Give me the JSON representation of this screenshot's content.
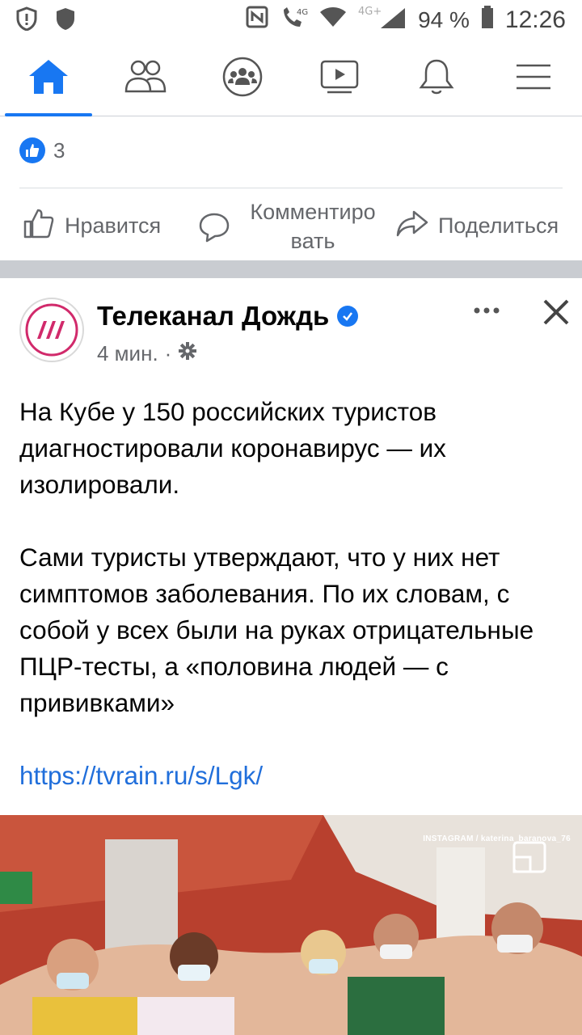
{
  "status_bar": {
    "network": "4G+",
    "battery": "94 %",
    "time": "12:26"
  },
  "nav": {
    "items": [
      {
        "id": "home",
        "icon": "home-icon",
        "active": true
      },
      {
        "id": "friends",
        "icon": "friends-icon",
        "active": false
      },
      {
        "id": "groups",
        "icon": "groups-icon",
        "active": false
      },
      {
        "id": "watch",
        "icon": "video-icon",
        "active": false
      },
      {
        "id": "notifications",
        "icon": "bell-icon",
        "active": false
      },
      {
        "id": "menu",
        "icon": "hamburger-icon",
        "active": false
      }
    ],
    "accent": "#1877f2"
  },
  "reactions": {
    "count": "3"
  },
  "actions": {
    "like": "Нравится",
    "comment": "Комментиро\nвать",
    "share": "Поделиться"
  },
  "post": {
    "page_name": "Телеканал Дождь",
    "time": "4 мин.",
    "paragraph1": "На Кубе у 150 российских туристов диагностировали коронавирус — их изолировали.",
    "paragraph2": "Сами туристы утверждают, что у них нет симптомов заболевания. По их словам, с собой у всех были на руках отрицательные ПЦР-тесты, а «половина людей — с прививками»",
    "link": "https://tvrain.ru/s/Lgk/"
  },
  "video": {
    "watermark": "INSTAGRAM / katerina_baranova_76"
  }
}
